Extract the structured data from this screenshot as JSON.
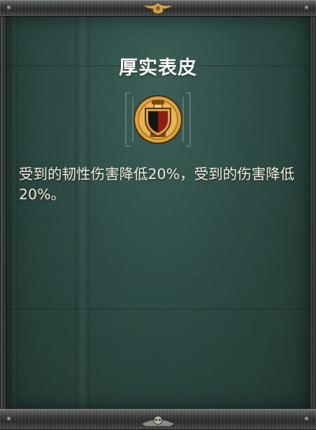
{
  "tooltip": {
    "title": "厚实表皮",
    "icon": "shield-buff-icon",
    "description": "受到的韧性伤害降低20%，受到的伤害降低20%。"
  },
  "colors": {
    "panel": "#2c4a43",
    "title_text": "#ffffff",
    "description_text": "#f4ecdc",
    "icon_gold": "#d9a441",
    "icon_red": "#8e1e14"
  }
}
